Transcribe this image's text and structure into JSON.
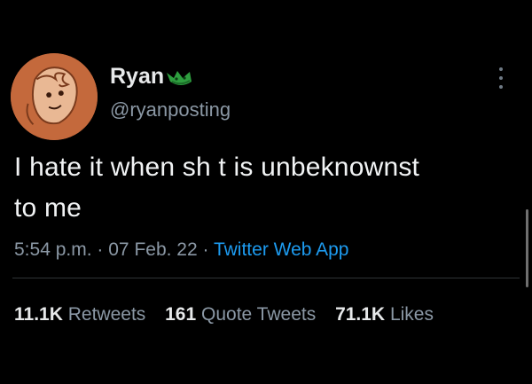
{
  "author": {
    "display_name": "Ryan",
    "handle": "@ryanposting"
  },
  "tweet": {
    "text_line1": "I hate it when sh t is unbeknownst",
    "text_line2": "to me"
  },
  "meta": {
    "time": "5:54 p.m.",
    "date": "07 Feb. 22",
    "separator": "·",
    "source": "Twitter Web App"
  },
  "stats": {
    "retweets_count": "11.1K",
    "retweets_label": "Retweets",
    "quotes_count": "161",
    "quotes_label": "Quote Tweets",
    "likes_count": "71.1K",
    "likes_label": "Likes"
  },
  "icons": {
    "avatar": "avatar-illustration",
    "badge": "emoji-badge-icon",
    "more": "more-options-icon"
  },
  "colors": {
    "background": "#000000",
    "primary_text": "#e7e9ea",
    "secondary_text": "#8b98a5",
    "link": "#1d9bf0",
    "divider": "#2f3336",
    "avatar_bg": "#c4693c"
  }
}
